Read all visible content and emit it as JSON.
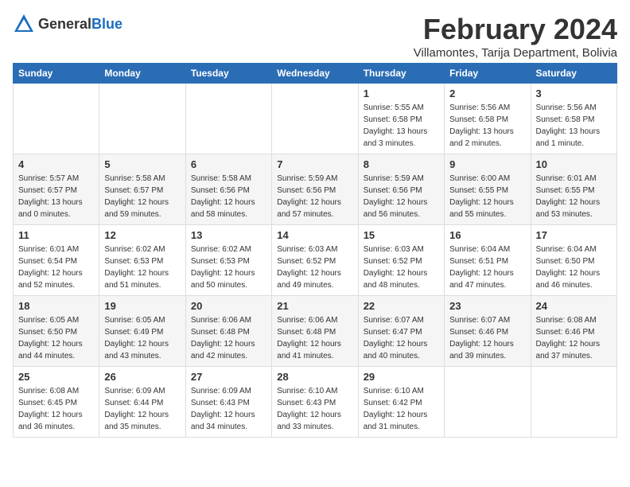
{
  "header": {
    "logo_general": "General",
    "logo_blue": "Blue",
    "title": "February 2024",
    "location": "Villamontes, Tarija Department, Bolivia"
  },
  "days_of_week": [
    "Sunday",
    "Monday",
    "Tuesday",
    "Wednesday",
    "Thursday",
    "Friday",
    "Saturday"
  ],
  "weeks": [
    [
      {
        "day": "",
        "info": ""
      },
      {
        "day": "",
        "info": ""
      },
      {
        "day": "",
        "info": ""
      },
      {
        "day": "",
        "info": ""
      },
      {
        "day": "1",
        "info": "Sunrise: 5:55 AM\nSunset: 6:58 PM\nDaylight: 13 hours\nand 3 minutes."
      },
      {
        "day": "2",
        "info": "Sunrise: 5:56 AM\nSunset: 6:58 PM\nDaylight: 13 hours\nand 2 minutes."
      },
      {
        "day": "3",
        "info": "Sunrise: 5:56 AM\nSunset: 6:58 PM\nDaylight: 13 hours\nand 1 minute."
      }
    ],
    [
      {
        "day": "4",
        "info": "Sunrise: 5:57 AM\nSunset: 6:57 PM\nDaylight: 13 hours\nand 0 minutes."
      },
      {
        "day": "5",
        "info": "Sunrise: 5:58 AM\nSunset: 6:57 PM\nDaylight: 12 hours\nand 59 minutes."
      },
      {
        "day": "6",
        "info": "Sunrise: 5:58 AM\nSunset: 6:56 PM\nDaylight: 12 hours\nand 58 minutes."
      },
      {
        "day": "7",
        "info": "Sunrise: 5:59 AM\nSunset: 6:56 PM\nDaylight: 12 hours\nand 57 minutes."
      },
      {
        "day": "8",
        "info": "Sunrise: 5:59 AM\nSunset: 6:56 PM\nDaylight: 12 hours\nand 56 minutes."
      },
      {
        "day": "9",
        "info": "Sunrise: 6:00 AM\nSunset: 6:55 PM\nDaylight: 12 hours\nand 55 minutes."
      },
      {
        "day": "10",
        "info": "Sunrise: 6:01 AM\nSunset: 6:55 PM\nDaylight: 12 hours\nand 53 minutes."
      }
    ],
    [
      {
        "day": "11",
        "info": "Sunrise: 6:01 AM\nSunset: 6:54 PM\nDaylight: 12 hours\nand 52 minutes."
      },
      {
        "day": "12",
        "info": "Sunrise: 6:02 AM\nSunset: 6:53 PM\nDaylight: 12 hours\nand 51 minutes."
      },
      {
        "day": "13",
        "info": "Sunrise: 6:02 AM\nSunset: 6:53 PM\nDaylight: 12 hours\nand 50 minutes."
      },
      {
        "day": "14",
        "info": "Sunrise: 6:03 AM\nSunset: 6:52 PM\nDaylight: 12 hours\nand 49 minutes."
      },
      {
        "day": "15",
        "info": "Sunrise: 6:03 AM\nSunset: 6:52 PM\nDaylight: 12 hours\nand 48 minutes."
      },
      {
        "day": "16",
        "info": "Sunrise: 6:04 AM\nSunset: 6:51 PM\nDaylight: 12 hours\nand 47 minutes."
      },
      {
        "day": "17",
        "info": "Sunrise: 6:04 AM\nSunset: 6:50 PM\nDaylight: 12 hours\nand 46 minutes."
      }
    ],
    [
      {
        "day": "18",
        "info": "Sunrise: 6:05 AM\nSunset: 6:50 PM\nDaylight: 12 hours\nand 44 minutes."
      },
      {
        "day": "19",
        "info": "Sunrise: 6:05 AM\nSunset: 6:49 PM\nDaylight: 12 hours\nand 43 minutes."
      },
      {
        "day": "20",
        "info": "Sunrise: 6:06 AM\nSunset: 6:48 PM\nDaylight: 12 hours\nand 42 minutes."
      },
      {
        "day": "21",
        "info": "Sunrise: 6:06 AM\nSunset: 6:48 PM\nDaylight: 12 hours\nand 41 minutes."
      },
      {
        "day": "22",
        "info": "Sunrise: 6:07 AM\nSunset: 6:47 PM\nDaylight: 12 hours\nand 40 minutes."
      },
      {
        "day": "23",
        "info": "Sunrise: 6:07 AM\nSunset: 6:46 PM\nDaylight: 12 hours\nand 39 minutes."
      },
      {
        "day": "24",
        "info": "Sunrise: 6:08 AM\nSunset: 6:46 PM\nDaylight: 12 hours\nand 37 minutes."
      }
    ],
    [
      {
        "day": "25",
        "info": "Sunrise: 6:08 AM\nSunset: 6:45 PM\nDaylight: 12 hours\nand 36 minutes."
      },
      {
        "day": "26",
        "info": "Sunrise: 6:09 AM\nSunset: 6:44 PM\nDaylight: 12 hours\nand 35 minutes."
      },
      {
        "day": "27",
        "info": "Sunrise: 6:09 AM\nSunset: 6:43 PM\nDaylight: 12 hours\nand 34 minutes."
      },
      {
        "day": "28",
        "info": "Sunrise: 6:10 AM\nSunset: 6:43 PM\nDaylight: 12 hours\nand 33 minutes."
      },
      {
        "day": "29",
        "info": "Sunrise: 6:10 AM\nSunset: 6:42 PM\nDaylight: 12 hours\nand 31 minutes."
      },
      {
        "day": "",
        "info": ""
      },
      {
        "day": "",
        "info": ""
      }
    ]
  ]
}
